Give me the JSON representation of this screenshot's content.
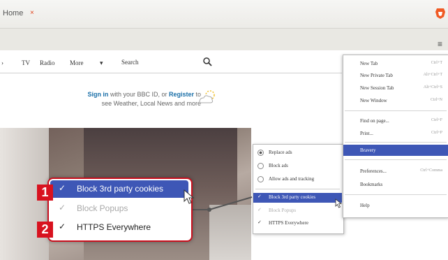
{
  "browser": {
    "tab_title": "Home",
    "tab_close": "×",
    "menu_icon": "hamburger-menu-icon",
    "brave_icon": "brave-lion-icon"
  },
  "bbc_nav": {
    "items": [
      "TV",
      "Radio",
      "More"
    ],
    "more_caret": "▾",
    "search_label": "Search"
  },
  "signin": {
    "sign_in": "Sign in",
    "mid": " with your BBC ID, or ",
    "register": "Register",
    "end": " to",
    "line2": "see Weather, Local News and more"
  },
  "zoom_menu": {
    "items": [
      {
        "label": "Block 3rd party cookies",
        "check": "✓"
      },
      {
        "label": "Block Popups",
        "check": "✓"
      },
      {
        "label": "HTTPS Everywhere",
        "check": "✓"
      }
    ],
    "badges": [
      "1",
      "2"
    ]
  },
  "brave_submenu": {
    "radio_items": [
      "Replace ads",
      "Block ads",
      "Allow ads and tracking"
    ],
    "check_items": [
      "Block 3rd party cookies",
      "Block Popups",
      "HTTPS Everywhere"
    ],
    "check_mark": "✓"
  },
  "main_menu": {
    "items": [
      {
        "label": "New Tab",
        "shortcut": "Ctrl+T"
      },
      {
        "label": "New Private Tab",
        "shortcut": "Alt+Ctrl+T"
      },
      {
        "label": "New Session Tab",
        "shortcut": "Alt+Ctrl+S"
      },
      {
        "label": "New Window",
        "shortcut": "Ctrl+N"
      },
      {
        "label": "Find on page...",
        "shortcut": "Ctrl+F"
      },
      {
        "label": "Print...",
        "shortcut": "Ctrl+P"
      },
      {
        "label": "Bravery",
        "shortcut": ""
      },
      {
        "label": "Preferences...",
        "shortcut": "Ctrl+Comma"
      },
      {
        "label": "Bookmarks",
        "shortcut": ""
      },
      {
        "label": "Help",
        "shortcut": ""
      }
    ]
  },
  "colors": {
    "highlight": "#3e57b6",
    "badge_red": "#d8121f",
    "link_blue": "#1a6fa8"
  }
}
